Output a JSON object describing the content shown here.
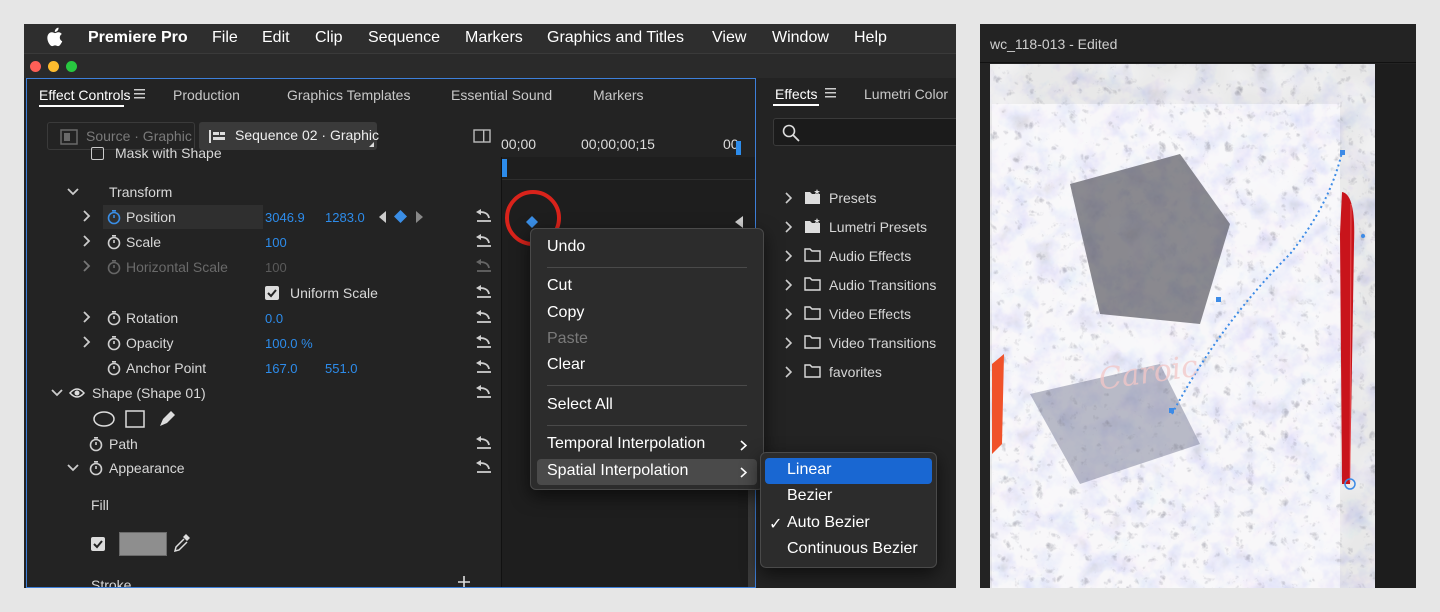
{
  "menubar": {
    "app": "Premiere Pro",
    "items": [
      "File",
      "Edit",
      "Clip",
      "Sequence",
      "Markers",
      "Graphics and Titles",
      "View",
      "Window",
      "Help"
    ]
  },
  "panel": {
    "tabs": [
      "Effect Controls",
      "Production",
      "Graphics Templates",
      "Essential Sound",
      "Markers"
    ],
    "source_label": "Source · Graphic",
    "sequence_label": "Sequence 02 · Graphic",
    "ruler": [
      "00;00",
      "00;00;00;15",
      "00"
    ],
    "rows": {
      "mask": "Mask with Shape",
      "transform": "Transform",
      "position": {
        "label": "Position",
        "x": "3046.9",
        "y": "1283.0"
      },
      "scale": {
        "label": "Scale",
        "value": "100"
      },
      "hscale": {
        "label": "Horizontal Scale",
        "value": "100"
      },
      "uniform": "Uniform Scale",
      "rotation": {
        "label": "Rotation",
        "value": "0.0"
      },
      "opacity": {
        "label": "Opacity",
        "value": "100.0 %"
      },
      "anchor": {
        "label": "Anchor Point",
        "x": "167.0",
        "y": "551.0"
      },
      "shape": "Shape (Shape 01)",
      "path": "Path",
      "appearance": "Appearance",
      "fill": "Fill",
      "stroke": "Stroke"
    }
  },
  "effects": {
    "tabs": [
      "Effects",
      "Lumetri Color"
    ],
    "folders": [
      "Presets",
      "Lumetri Presets",
      "Audio Effects",
      "Audio Transitions",
      "Video Effects",
      "Video Transitions",
      "favorites"
    ]
  },
  "context_menu": {
    "undo": "Undo",
    "cut": "Cut",
    "copy": "Copy",
    "paste": "Paste",
    "clear": "Clear",
    "select_all": "Select All",
    "temporal": "Temporal Interpolation",
    "spatial": "Spatial Interpolation"
  },
  "submenu": {
    "items": [
      "Linear",
      "Bezier",
      "Auto Bezier",
      "Continuous Bezier"
    ],
    "checked_mark": "✓",
    "highlighted": "Linear",
    "checked": "Auto Bezier"
  },
  "right_window": {
    "title": "wc_118-013 - Edited"
  },
  "colors": {
    "accent_blue": "#2d8ceb",
    "highlight": "#1967d2",
    "red_circle": "#d9231b",
    "keyframe": "#3a8ee6"
  }
}
